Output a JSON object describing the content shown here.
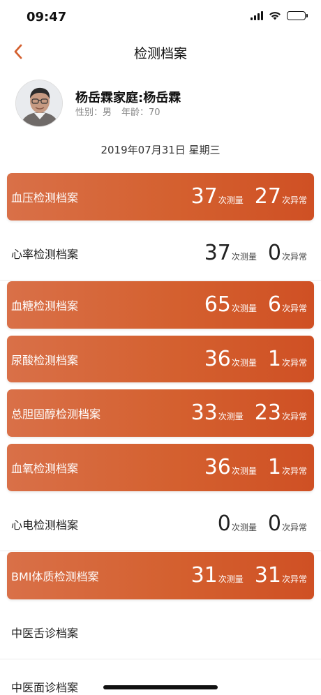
{
  "status_bar": {
    "time": "09:47",
    "icons": [
      "signal-icon",
      "wifi-icon",
      "battery-icon"
    ]
  },
  "nav": {
    "back_icon": "chevron-left-icon",
    "title": "检测档案"
  },
  "profile": {
    "name": "杨岳霖家庭:杨岳霖",
    "gender": "性别：男",
    "age": "年龄：70"
  },
  "date": "2019年07月31日 星期三",
  "colors": {
    "accent": "#d4602f",
    "accent_light": "#d97048",
    "accent_dark": "#cf5024"
  },
  "records": [
    {
      "label": "血压检测档案",
      "measured": "37",
      "measured_unit": "次测量",
      "abnormal": "27",
      "abnormal_unit": "次异常",
      "highlighted": true
    },
    {
      "label": "心率检测档案",
      "measured": "37",
      "measured_unit": "次测量",
      "abnormal": "0",
      "abnormal_unit": "次异常",
      "highlighted": false
    },
    {
      "label": "血糖检测档案",
      "measured": "65",
      "measured_unit": "次测量",
      "abnormal": "6",
      "abnormal_unit": "次异常",
      "highlighted": true
    },
    {
      "label": "尿酸检测档案",
      "measured": "36",
      "measured_unit": "次测量",
      "abnormal": "1",
      "abnormal_unit": "次异常",
      "highlighted": true
    },
    {
      "label": "总胆固醇检测档案",
      "measured": "33",
      "measured_unit": "次测量",
      "abnormal": "23",
      "abnormal_unit": "次异常",
      "highlighted": true
    },
    {
      "label": "血氧检测档案",
      "measured": "36",
      "measured_unit": "次测量",
      "abnormal": "1",
      "abnormal_unit": "次异常",
      "highlighted": true
    },
    {
      "label": "心电检测档案",
      "measured": "0",
      "measured_unit": "次测量",
      "abnormal": "0",
      "abnormal_unit": "次异常",
      "highlighted": false
    },
    {
      "label": "BMI体质检测档案",
      "measured": "31",
      "measured_unit": "次测量",
      "abnormal": "31",
      "abnormal_unit": "次异常",
      "highlighted": true
    },
    {
      "label": "中医舌诊档案",
      "highlighted": false
    },
    {
      "label": "中医面诊档案",
      "highlighted": false
    }
  ]
}
